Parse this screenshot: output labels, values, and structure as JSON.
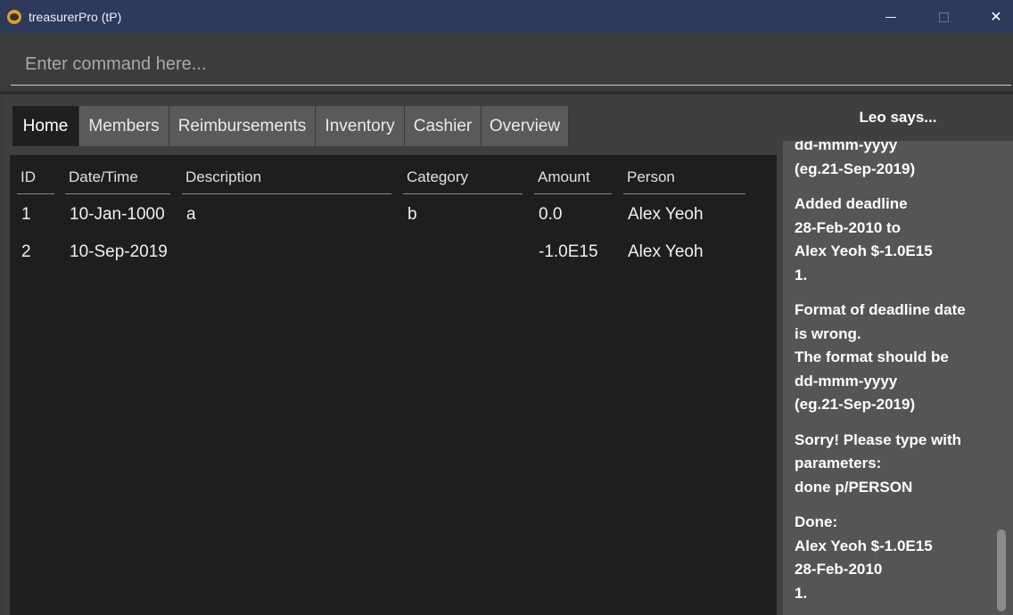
{
  "window": {
    "title": "treasurerPro (tP)",
    "close_glyph": "✕"
  },
  "command": {
    "placeholder": "Enter command here..."
  },
  "tabs": [
    {
      "label": "Home",
      "active": true
    },
    {
      "label": "Members",
      "active": false
    },
    {
      "label": "Reimbursements",
      "active": false
    },
    {
      "label": "Inventory",
      "active": false
    },
    {
      "label": "Cashier",
      "active": false
    },
    {
      "label": "Overview",
      "active": false
    }
  ],
  "table": {
    "headers": {
      "id": "ID",
      "date": "Date/Time",
      "description": "Description",
      "category": "Category",
      "amount": "Amount",
      "person": "Person"
    },
    "rows": [
      {
        "id": "1",
        "date": "10-Jan-1000",
        "description": "a",
        "category": "b",
        "amount": "0.0",
        "person": "Alex Yeoh"
      },
      {
        "id": "2",
        "date": "10-Sep-2019",
        "description": "",
        "category": "",
        "amount": "-1.0E15",
        "person": "Alex Yeoh"
      }
    ]
  },
  "leo": {
    "header": "Leo says...",
    "messages": [
      "dd-mmm-yyyy\n(eg.21-Sep-2019)",
      "Added deadline\n28-Feb-2010 to\nAlex Yeoh $-1.0E15\n1.",
      "Format of deadline date\nis wrong.\nThe format should be\ndd-mmm-yyyy\n(eg.21-Sep-2019)",
      "Sorry! Please type with\nparameters:\ndone p/PERSON",
      "Done:\nAlex Yeoh $-1.0E15\n28-Feb-2010\n1."
    ]
  },
  "colors": {
    "titlebar": "#2e3a5c",
    "background": "#3c3c3c",
    "table_bg": "#1e1e1e",
    "tab_active": "#1f1f1f",
    "tab_inactive": "#5a5a5a",
    "leo_panel": "#555555"
  },
  "icons": {
    "app": "bear-logo-icon",
    "minimize": "minimize-icon",
    "maximize": "maximize-icon",
    "close": "close-icon"
  }
}
